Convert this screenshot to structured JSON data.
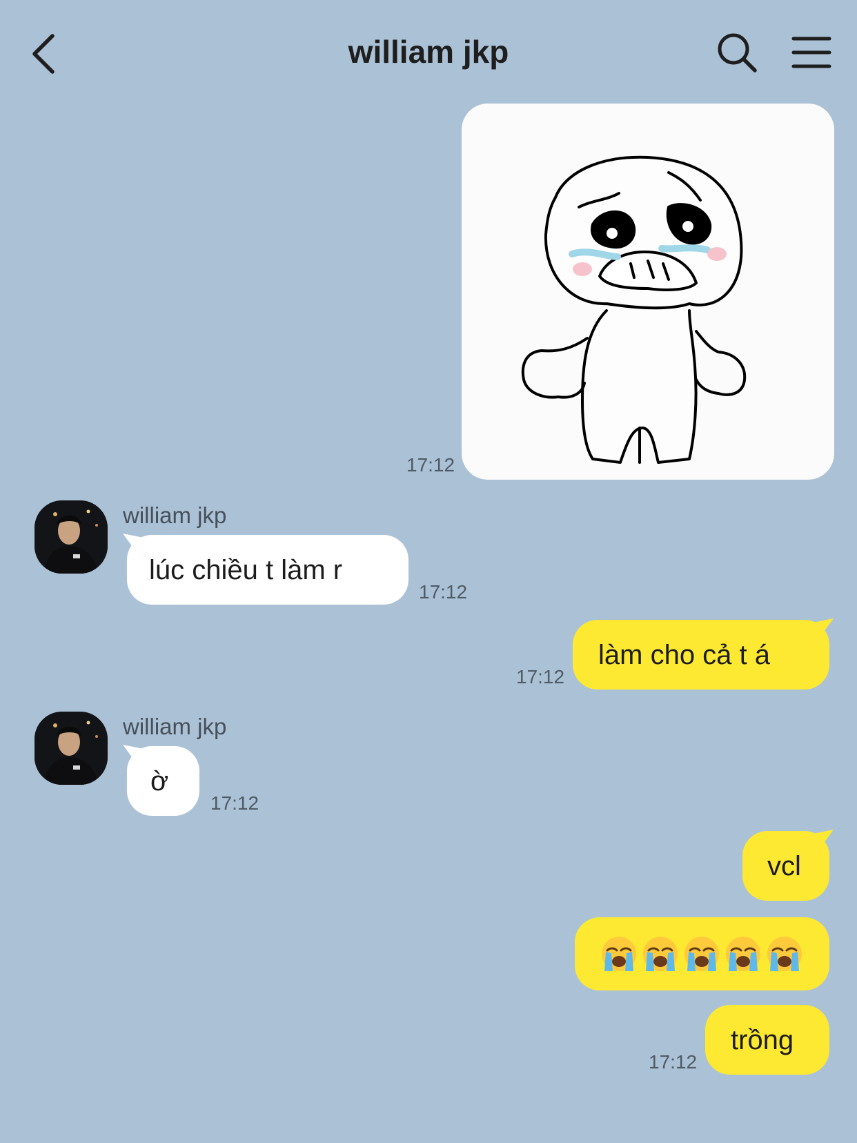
{
  "header": {
    "title": "william jkp"
  },
  "messages": {
    "sticker": {
      "time": "17:12",
      "description": "crying sticker"
    },
    "incoming_1": {
      "sender": "william jkp",
      "text": "lúc chiều t làm r",
      "time": "17:12"
    },
    "outgoing_1": {
      "text": "làm cho cả t á",
      "time": "17:12"
    },
    "incoming_2": {
      "sender": "william jkp",
      "text": "ờ",
      "time": "17:12"
    },
    "outgoing_2": {
      "text": "vcl"
    },
    "outgoing_3": {
      "emoji": "loudly-crying-face",
      "count": 5
    },
    "outgoing_4": {
      "text": "trồng",
      "time": "17:12"
    }
  },
  "colors": {
    "background": "#abc1d6",
    "outgoing_bubble": "#fee932",
    "incoming_bubble": "#ffffff"
  }
}
